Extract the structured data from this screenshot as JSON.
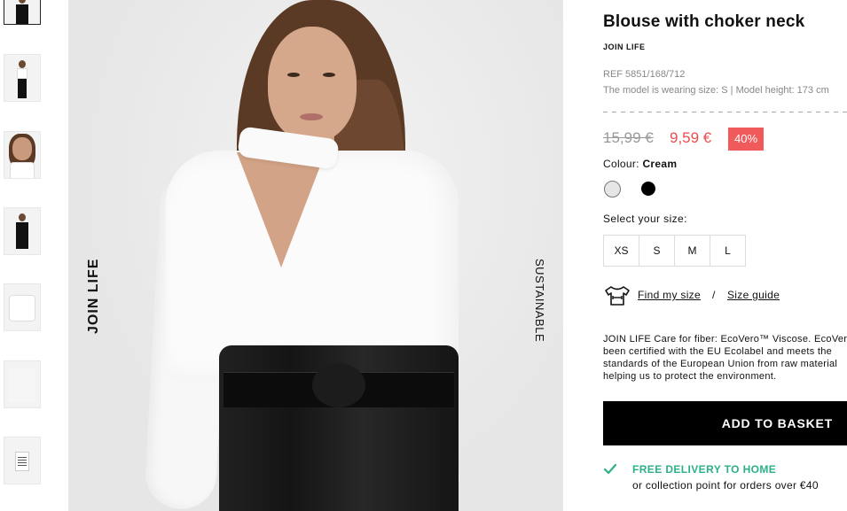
{
  "thumbnails": [
    {
      "name": "thumbnail-1",
      "active": true
    },
    {
      "name": "thumbnail-2",
      "active": false
    },
    {
      "name": "thumbnail-3",
      "active": false
    },
    {
      "name": "thumbnail-4",
      "active": false
    },
    {
      "name": "thumbnail-5",
      "active": false
    },
    {
      "name": "thumbnail-6",
      "active": false
    },
    {
      "name": "thumbnail-7",
      "active": false
    }
  ],
  "hero": {
    "left_text": "JOIN LIFE",
    "right_text": "SUSTAINABLE"
  },
  "product": {
    "title": "Blouse with choker neck",
    "brand_tag": "JOIN LIFE",
    "ref": "REF 5851/168/712",
    "model_info": "The model is wearing size: S | Model height: 173 cm",
    "old_price": "15,99 €",
    "new_price": "9,59 €",
    "discount": "40%",
    "colour_label": "Colour:",
    "colour_value": "Cream",
    "colours": [
      {
        "name": "Cream",
        "hex": "#e6e6e6"
      },
      {
        "name": "Black",
        "hex": "#000000"
      }
    ],
    "select_size_label": "Select your size:",
    "sizes": [
      "XS",
      "S",
      "M",
      "L"
    ],
    "find_my_size": "Find my size",
    "separator": "/",
    "size_guide": "Size guide",
    "care_lines": [
      "JOIN LIFE Care for fiber: EcoVero™ Viscose. EcoVero™ has",
      "been certified with the EU Ecolabel and meets the",
      "standards of the European Union from raw material",
      "helping us to protect the environment."
    ],
    "add_to_basket": "ADD TO BASKET",
    "delivery_title": "FREE DELIVERY TO HOME",
    "delivery_sub": "or collection point for orders over €40"
  },
  "colors": {
    "sale": "#e94e4e",
    "discount_bg": "#f05a5a",
    "delivery_green": "#2bb08a",
    "button_bg": "#000000"
  },
  "icons": {
    "shirt": "tshirt-measure-icon",
    "check": "check-icon"
  }
}
